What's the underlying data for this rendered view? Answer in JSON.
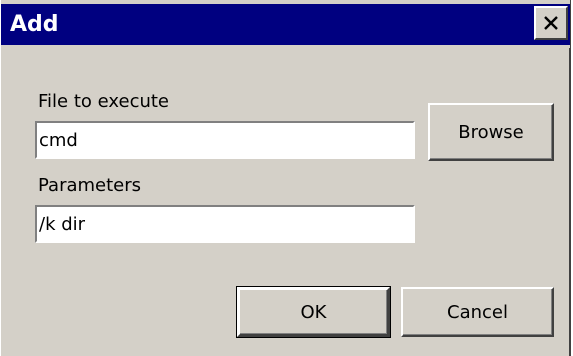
{
  "window": {
    "title": "Add",
    "close_icon": "close-icon"
  },
  "form": {
    "file_label": "File to execute",
    "file_value": "cmd",
    "params_label": "Parameters",
    "params_value": "/k dir"
  },
  "buttons": {
    "browse": "Browse",
    "ok": "OK",
    "cancel": "Cancel"
  },
  "colors": {
    "titlebar": "#000080",
    "face": "#d4d0c8"
  }
}
